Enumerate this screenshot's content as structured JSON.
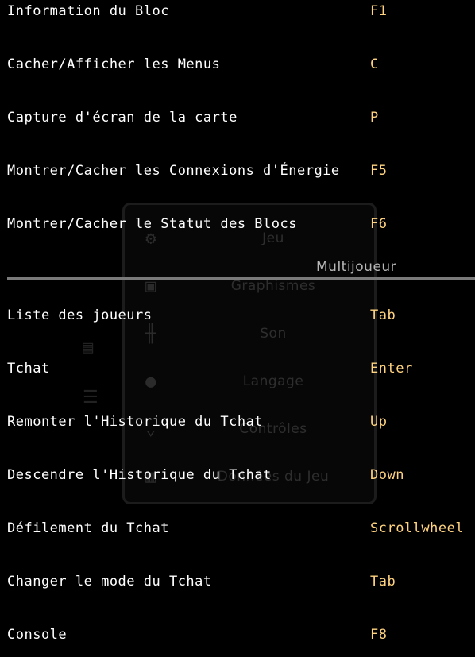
{
  "background_menu": {
    "items": [
      {
        "label": "Jeu",
        "icon": "gear-icon"
      },
      {
        "label": "Graphismes",
        "icon": "image-icon"
      },
      {
        "label": "Son",
        "icon": "equalizer-icon"
      },
      {
        "label": "Langage",
        "icon": "speech-bubble-icon"
      },
      {
        "label": "Contrôles",
        "icon": "controls-icon"
      },
      {
        "label": "Données du Jeu",
        "icon": "data-icon"
      }
    ]
  },
  "keybinds_top": [
    {
      "action": "Information du Bloc",
      "key": "F1"
    },
    {
      "action": "Cacher/Afficher les Menus",
      "key": "C"
    },
    {
      "action": "Capture d'écran de la carte",
      "key": "P"
    },
    {
      "action": "Montrer/Cacher les Connexions d'Énergie",
      "key": "F5"
    },
    {
      "action": "Montrer/Cacher le Statut des Blocs",
      "key": "F6"
    }
  ],
  "section": {
    "title": "Multijoueur"
  },
  "keybinds_multiplayer": [
    {
      "action": "Liste des joueurs",
      "key": "Tab"
    },
    {
      "action": "Tchat",
      "key": "Enter"
    },
    {
      "action": "Remonter l'Historique du Tchat",
      "key": "Up"
    },
    {
      "action": "Descendre l'Historique du Tchat",
      "key": "Down"
    },
    {
      "action": "Défilement du Tchat",
      "key": "Scrollwheel"
    },
    {
      "action": "Changer le mode du Tchat",
      "key": "Tab"
    },
    {
      "action": "Console",
      "key": "F8"
    }
  ],
  "colors": {
    "background": "#000000",
    "action_text": "#ffffff",
    "key_text": "#ffd37f",
    "divider": "#7a7a7a"
  }
}
